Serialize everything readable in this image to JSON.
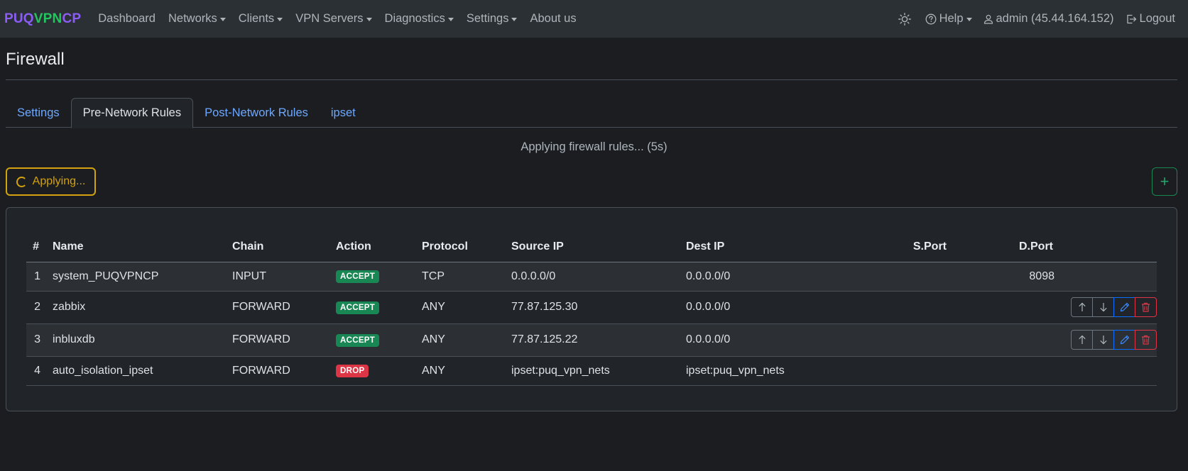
{
  "brand": {
    "letters": [
      "P",
      "U",
      "Q",
      "V",
      "P",
      "N",
      "C",
      "P"
    ],
    "colors": [
      "#8b5cf6",
      "#8b5cf6",
      "#8b5cf6",
      "#22c55e",
      "#22c55e",
      "#22c55e",
      "#8b5cf6",
      "#8b5cf6"
    ]
  },
  "nav": {
    "items": [
      "Dashboard",
      "Networks",
      "Clients",
      "VPN Servers",
      "Diagnostics",
      "Settings",
      "About us"
    ],
    "help": "Help",
    "user": "admin (45.44.164.152)",
    "logout": "Logout"
  },
  "page": {
    "title": "Firewall"
  },
  "tabs": [
    "Settings",
    "Pre-Network Rules",
    "Post-Network Rules",
    "ipset"
  ],
  "status": {
    "message": "Applying firewall rules... (5s)",
    "applying_label": "Applying...",
    "add_label": "+"
  },
  "table": {
    "headers": [
      "#",
      "Name",
      "Chain",
      "Action",
      "Protocol",
      "Source IP",
      "Dest IP",
      "S.Port",
      "D.Port"
    ],
    "rows": [
      {
        "n": "1",
        "name": "system_PUQVPNCP",
        "chain": "INPUT",
        "action": "ACCEPT",
        "protocol": "TCP",
        "src": "0.0.0.0/0",
        "dst": "0.0.0.0/0",
        "sport": "",
        "dport": "8098"
      },
      {
        "n": "2",
        "name": "zabbix",
        "chain": "FORWARD",
        "action": "ACCEPT",
        "protocol": "ANY",
        "src": "77.87.125.30",
        "dst": "0.0.0.0/0",
        "sport": "",
        "dport": ""
      },
      {
        "n": "3",
        "name": "inbluxdb",
        "chain": "FORWARD",
        "action": "ACCEPT",
        "protocol": "ANY",
        "src": "77.87.125.22",
        "dst": "0.0.0.0/0",
        "sport": "",
        "dport": ""
      },
      {
        "n": "4",
        "name": "auto_isolation_ipset",
        "chain": "FORWARD",
        "action": "DROP",
        "protocol": "ANY",
        "src": "ipset:puq_vpn_nets",
        "dst": "ipset:puq_vpn_nets",
        "sport": "",
        "dport": ""
      }
    ]
  },
  "colors": {
    "accept": "#198754",
    "drop": "#dc3545",
    "warning": "#d4a20e",
    "link": "#6ea8fe"
  }
}
